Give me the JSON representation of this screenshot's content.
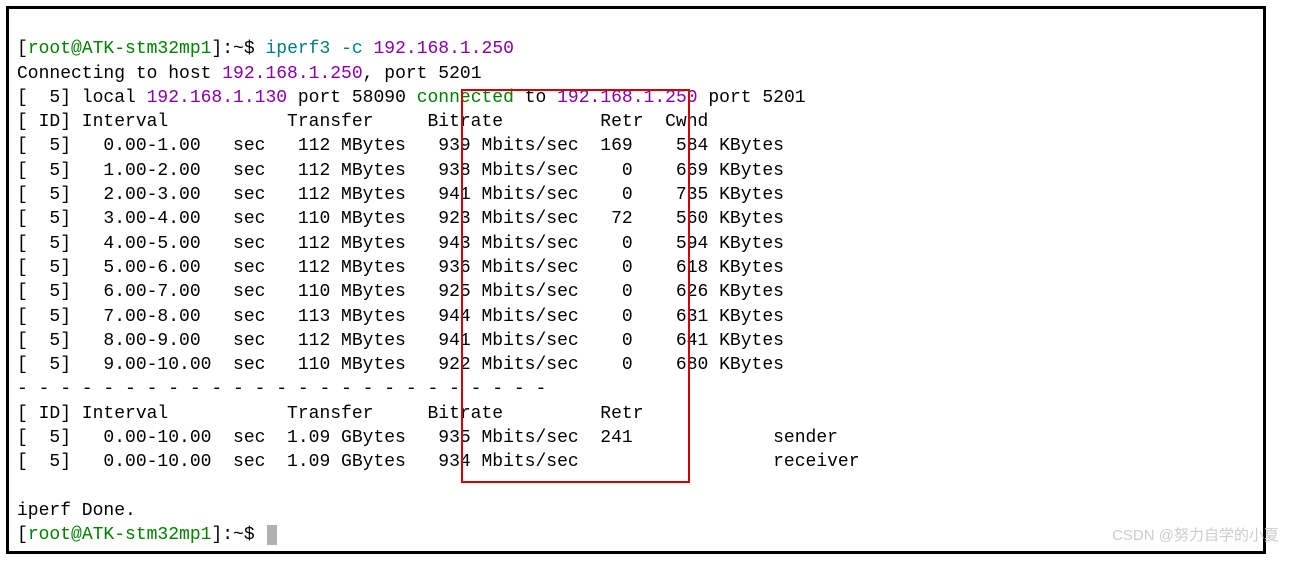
{
  "prompt": {
    "open": "[",
    "user_host": "root@ATK-stm32mp1",
    "close": "]:~$ ",
    "command": "iperf3 -c ",
    "ip_arg": "192.168.1.250"
  },
  "connecting": {
    "prefix": "Connecting to host ",
    "ip": "192.168.1.250",
    "suffix": ", port 5201"
  },
  "connected_line": {
    "p1": "[  5] local ",
    "local_ip": "192.168.1.130",
    "p2": " port 58090 ",
    "connected": "connected",
    "p3": " to ",
    "remote_ip": "192.168.1.250",
    "p4": " port 5201"
  },
  "header1": "[ ID] Interval           Transfer     Bitrate         Retr  Cwnd",
  "rows": [
    "[  5]   0.00-1.00   sec   112 MBytes   939 Mbits/sec  169    584 KBytes",
    "[  5]   1.00-2.00   sec   112 MBytes   938 Mbits/sec    0    669 KBytes",
    "[  5]   2.00-3.00   sec   112 MBytes   941 Mbits/sec    0    735 KBytes",
    "[  5]   3.00-4.00   sec   110 MBytes   923 Mbits/sec   72    560 KBytes",
    "[  5]   4.00-5.00   sec   112 MBytes   943 Mbits/sec    0    594 KBytes",
    "[  5]   5.00-6.00   sec   112 MBytes   936 Mbits/sec    0    618 KBytes",
    "[  5]   6.00-7.00   sec   110 MBytes   925 Mbits/sec    0    626 KBytes",
    "[  5]   7.00-8.00   sec   113 MBytes   944 Mbits/sec    0    631 KBytes",
    "[  5]   8.00-9.00   sec   112 MBytes   941 Mbits/sec    0    641 KBytes",
    "[  5]   9.00-10.00  sec   110 MBytes   922 Mbits/sec    0    680 KBytes"
  ],
  "divider": "- - - - - - - - - - - - - - - - - - - - - - - - -",
  "header2": "[ ID] Interval           Transfer     Bitrate         Retr",
  "summary": [
    "[  5]   0.00-10.00  sec  1.09 GBytes   935 Mbits/sec  241             sender",
    "[  5]   0.00-10.00  sec  1.09 GBytes   934 Mbits/sec                  receiver"
  ],
  "done": "iperf Done.",
  "prompt2": {
    "open": "[",
    "user_host": "root@ATK-stm32mp1",
    "close": "]:~$ "
  },
  "watermark": "CSDN @努力自学的小夏",
  "chart_data": {
    "type": "table",
    "title": "iperf3 client output",
    "columns": [
      "ID",
      "Interval (sec)",
      "Transfer",
      "Bitrate",
      "Retr",
      "Cwnd"
    ],
    "interval_rows": [
      {
        "id": 5,
        "interval": "0.00-1.00",
        "transfer": "112 MBytes",
        "bitrate": "939 Mbits/sec",
        "retr": 169,
        "cwnd": "584 KBytes"
      },
      {
        "id": 5,
        "interval": "1.00-2.00",
        "transfer": "112 MBytes",
        "bitrate": "938 Mbits/sec",
        "retr": 0,
        "cwnd": "669 KBytes"
      },
      {
        "id": 5,
        "interval": "2.00-3.00",
        "transfer": "112 MBytes",
        "bitrate": "941 Mbits/sec",
        "retr": 0,
        "cwnd": "735 KBytes"
      },
      {
        "id": 5,
        "interval": "3.00-4.00",
        "transfer": "110 MBytes",
        "bitrate": "923 Mbits/sec",
        "retr": 72,
        "cwnd": "560 KBytes"
      },
      {
        "id": 5,
        "interval": "4.00-5.00",
        "transfer": "112 MBytes",
        "bitrate": "943 Mbits/sec",
        "retr": 0,
        "cwnd": "594 KBytes"
      },
      {
        "id": 5,
        "interval": "5.00-6.00",
        "transfer": "112 MBytes",
        "bitrate": "936 Mbits/sec",
        "retr": 0,
        "cwnd": "618 KBytes"
      },
      {
        "id": 5,
        "interval": "6.00-7.00",
        "transfer": "110 MBytes",
        "bitrate": "925 Mbits/sec",
        "retr": 0,
        "cwnd": "626 KBytes"
      },
      {
        "id": 5,
        "interval": "7.00-8.00",
        "transfer": "113 MBytes",
        "bitrate": "944 Mbits/sec",
        "retr": 0,
        "cwnd": "631 KBytes"
      },
      {
        "id": 5,
        "interval": "8.00-9.00",
        "transfer": "112 MBytes",
        "bitrate": "941 Mbits/sec",
        "retr": 0,
        "cwnd": "641 KBytes"
      },
      {
        "id": 5,
        "interval": "9.00-10.00",
        "transfer": "110 MBytes",
        "bitrate": "922 Mbits/sec",
        "retr": 0,
        "cwnd": "680 KBytes"
      }
    ],
    "summary_rows": [
      {
        "id": 5,
        "interval": "0.00-10.00",
        "transfer": "1.09 GBytes",
        "bitrate": "935 Mbits/sec",
        "retr": 241,
        "role": "sender"
      },
      {
        "id": 5,
        "interval": "0.00-10.00",
        "transfer": "1.09 GBytes",
        "bitrate": "934 Mbits/sec",
        "retr": null,
        "role": "receiver"
      }
    ]
  }
}
